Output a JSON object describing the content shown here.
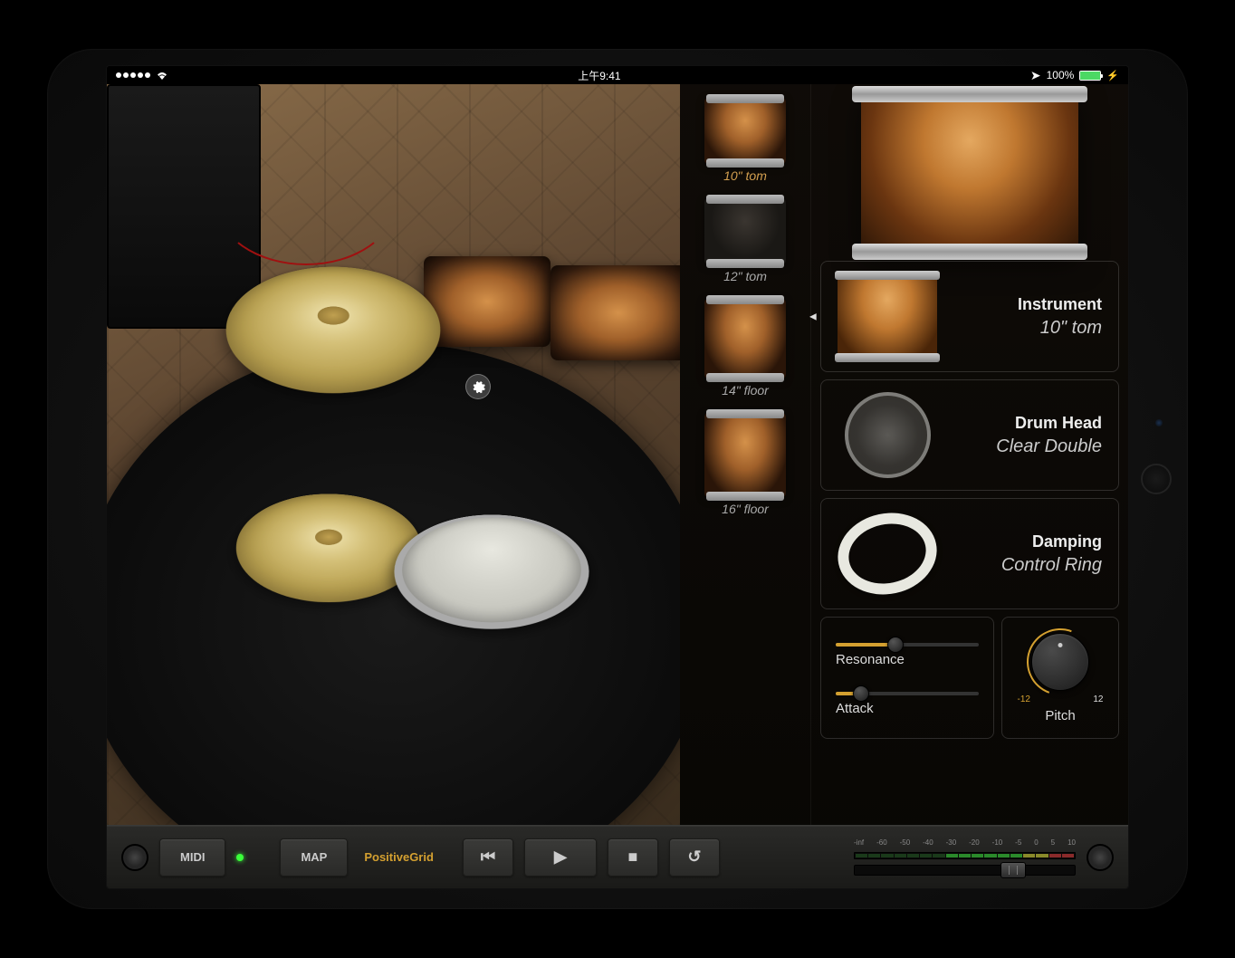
{
  "status": {
    "time": "上午9:41",
    "battery_pct": "100%"
  },
  "tom_list": [
    {
      "label": "10\" tom",
      "active": true,
      "dark": false
    },
    {
      "label": "12\" tom",
      "active": false,
      "dark": true
    },
    {
      "label": "14\" floor",
      "active": false,
      "dark": false
    },
    {
      "label": "16\" floor",
      "active": false,
      "dark": false
    }
  ],
  "params": {
    "instrument": {
      "title": "Instrument",
      "value": "10\" tom"
    },
    "drum_head": {
      "title": "Drum Head",
      "value": "Clear Double"
    },
    "damping": {
      "title": "Damping",
      "value": "Control Ring"
    }
  },
  "sliders": {
    "resonance": {
      "label": "Resonance",
      "value_pct": 42
    },
    "attack": {
      "label": "Attack",
      "value_pct": 18
    }
  },
  "pitch": {
    "label": "Pitch",
    "min": "-12",
    "max": "12"
  },
  "toolbar": {
    "midi": "MIDI",
    "map": "MAP",
    "brand": "PositiveGrid",
    "meter_ticks": [
      "-inf",
      "-60",
      "-50",
      "-40",
      "-30",
      "-20",
      "-10",
      "-5",
      "0",
      "5",
      "10"
    ]
  }
}
